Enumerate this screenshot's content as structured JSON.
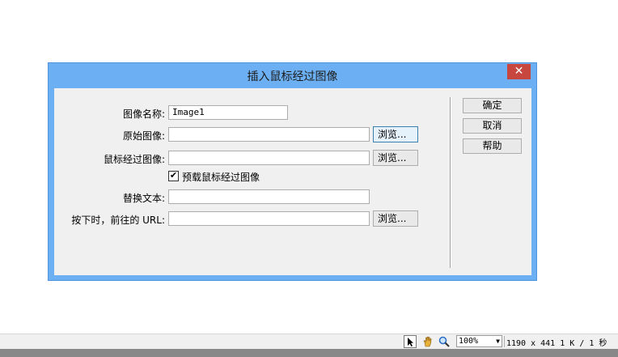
{
  "dialog": {
    "title": "插入鼠标经过图像",
    "close_glyph": "✕",
    "fields": {
      "image_name_label": "图像名称:",
      "image_name_value": "Image1",
      "original_label": "原始图像:",
      "original_value": "",
      "rollover_label": "鼠标经过图像:",
      "rollover_value": "",
      "preload_label": "预载鼠标经过图像",
      "preload_checked": "✔",
      "alt_label": "替换文本:",
      "alt_value": "",
      "link_label": "按下时，前往的 URL:",
      "link_value": ""
    },
    "browse_label": "浏览...",
    "buttons": {
      "ok": "确定",
      "cancel": "取消",
      "help": "帮助"
    }
  },
  "statusbar": {
    "pointer_icon": "arrow-pointer-icon",
    "hand_icon": "hand-icon",
    "zoom_icon": "magnifier-icon",
    "zoom_value": "100%",
    "dimensions": "1190 x 441",
    "filesize": "1 K / 1 秒"
  }
}
